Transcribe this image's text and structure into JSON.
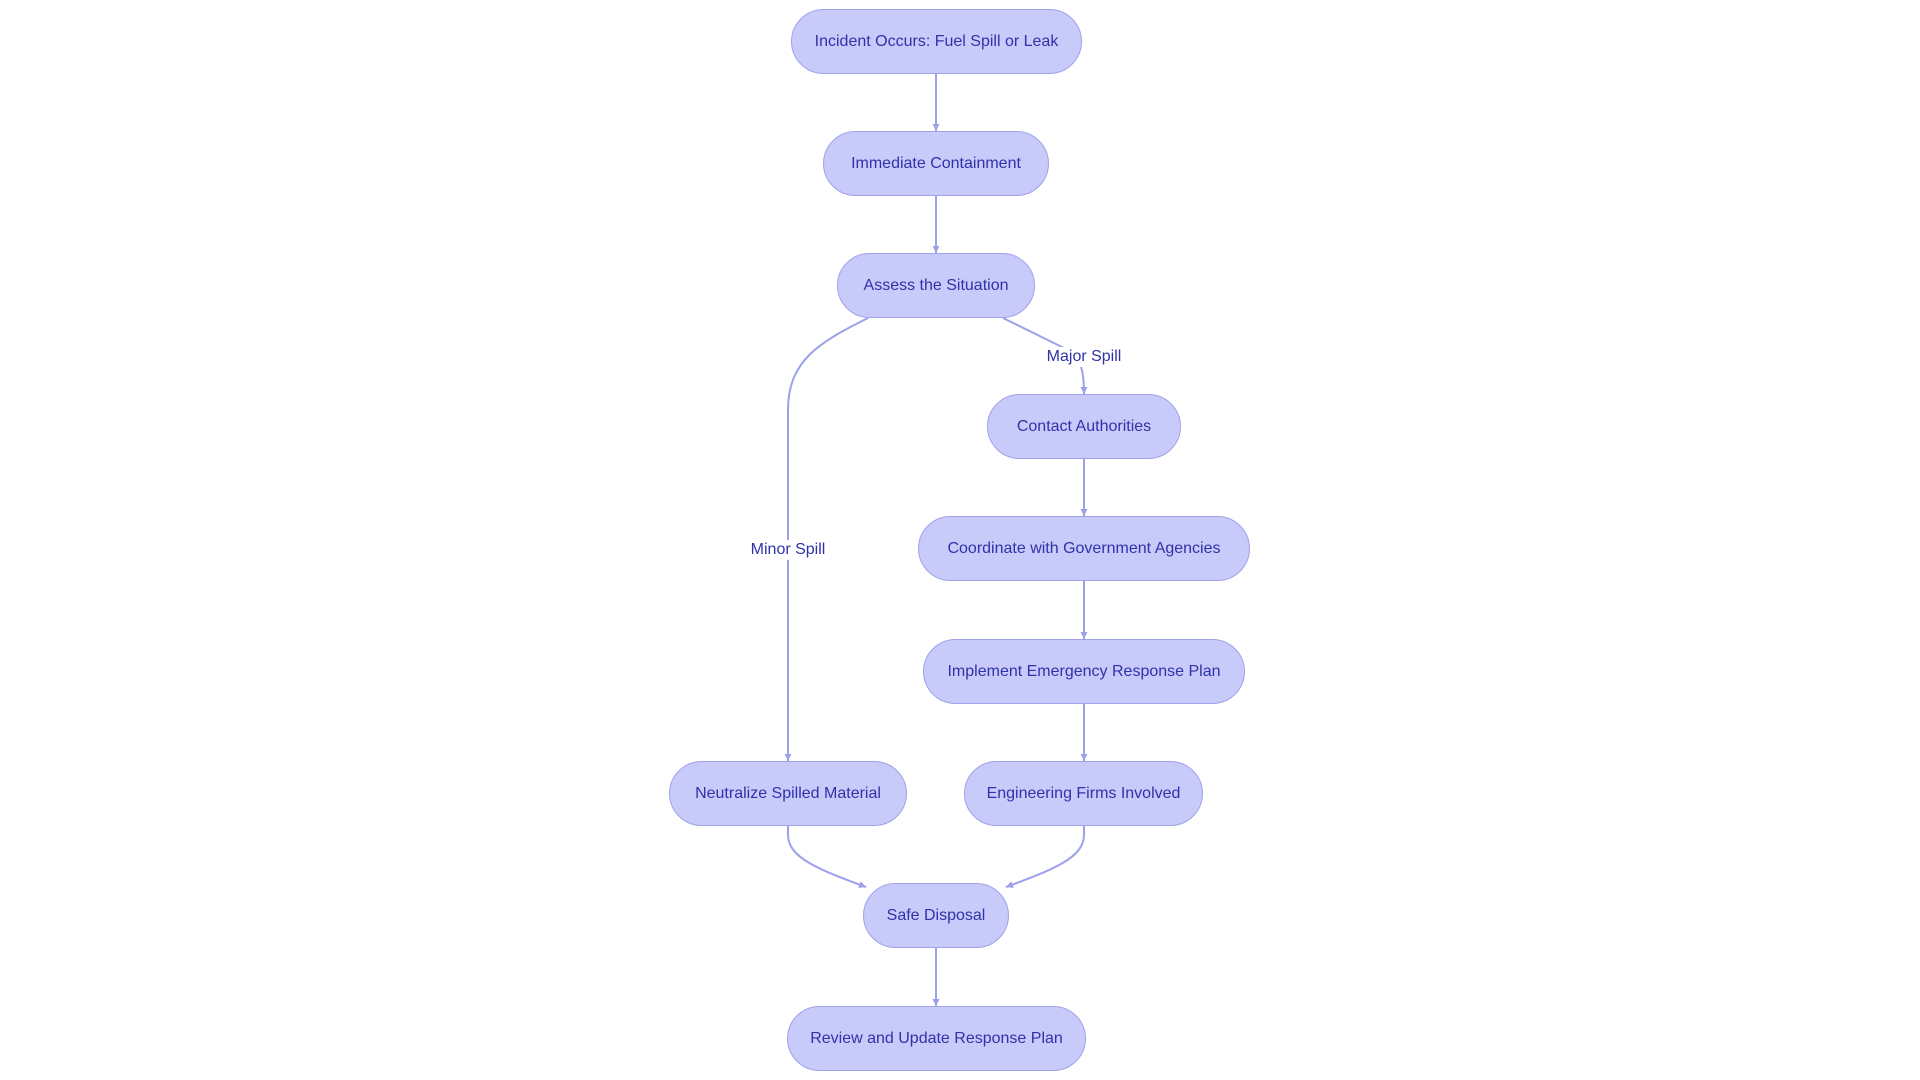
{
  "diagram": {
    "type": "flowchart",
    "direction": "top-to-bottom",
    "colors": {
      "node_fill": "#c8cafa",
      "node_border": "#9fa3e8",
      "node_text": "#2f32a8",
      "edge": "#9da1ea",
      "background": "#ffffff"
    },
    "nodes": [
      {
        "id": "incident",
        "label": "Incident Occurs: Fuel Spill or Leak",
        "shape": "stadium"
      },
      {
        "id": "containment",
        "label": "Immediate Containment",
        "shape": "stadium"
      },
      {
        "id": "assess",
        "label": "Assess the Situation",
        "shape": "stadium"
      },
      {
        "id": "contact",
        "label": "Contact Authorities",
        "shape": "stadium"
      },
      {
        "id": "coordinate",
        "label": "Coordinate with Government Agencies",
        "shape": "stadium"
      },
      {
        "id": "implement",
        "label": "Implement Emergency Response Plan",
        "shape": "stadium"
      },
      {
        "id": "engineering",
        "label": "Engineering Firms Involved",
        "shape": "stadium"
      },
      {
        "id": "neutralize",
        "label": "Neutralize Spilled Material",
        "shape": "stadium"
      },
      {
        "id": "disposal",
        "label": "Safe Disposal",
        "shape": "stadium"
      },
      {
        "id": "review",
        "label": "Review and Update Response Plan",
        "shape": "stadium"
      }
    ],
    "edges": [
      {
        "from": "incident",
        "to": "containment",
        "label": ""
      },
      {
        "from": "containment",
        "to": "assess",
        "label": ""
      },
      {
        "from": "assess",
        "to": "neutralize",
        "label": "Minor Spill"
      },
      {
        "from": "assess",
        "to": "contact",
        "label": "Major Spill"
      },
      {
        "from": "contact",
        "to": "coordinate",
        "label": ""
      },
      {
        "from": "coordinate",
        "to": "implement",
        "label": ""
      },
      {
        "from": "implement",
        "to": "engineering",
        "label": ""
      },
      {
        "from": "neutralize",
        "to": "disposal",
        "label": ""
      },
      {
        "from": "engineering",
        "to": "disposal",
        "label": ""
      },
      {
        "from": "disposal",
        "to": "review",
        "label": ""
      }
    ]
  }
}
